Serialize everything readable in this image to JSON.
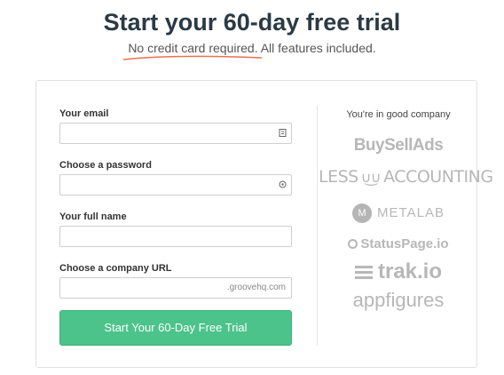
{
  "header": {
    "title": "Start your 60-day free trial",
    "subtitle": "No credit card required. All features included."
  },
  "form": {
    "email_label": "Your email",
    "email_value": "",
    "password_label": "Choose a password",
    "password_value": "",
    "fullname_label": "Your full name",
    "fullname_value": "",
    "company_url_label": "Choose a company URL",
    "company_url_value": "",
    "company_url_suffix": ".groovehq.com",
    "submit_label": "Start Your 60-Day Free Trial"
  },
  "companies": {
    "heading": "You're in good company",
    "logos": [
      {
        "name": "BuySellAds",
        "text": "BuySellAds"
      },
      {
        "name": "LessAccounting",
        "text_left": "LESS",
        "face": "∪͜∪",
        "text_right": "ACCOUNTING"
      },
      {
        "name": "Metalab",
        "badge": "M",
        "text": "METALAB"
      },
      {
        "name": "StatusPage",
        "text": "StatusPage.io"
      },
      {
        "name": "trak.io",
        "text": "trak.io"
      },
      {
        "name": "appfigures",
        "text": "appfigures"
      }
    ]
  },
  "colors": {
    "cta": "#4cc38a",
    "title": "#2b3a44",
    "underline": "#e8734f",
    "logo_gray": "#b7b7b7"
  },
  "icons": {
    "email_field": "contact-card-icon",
    "password_field": "key-icon"
  }
}
